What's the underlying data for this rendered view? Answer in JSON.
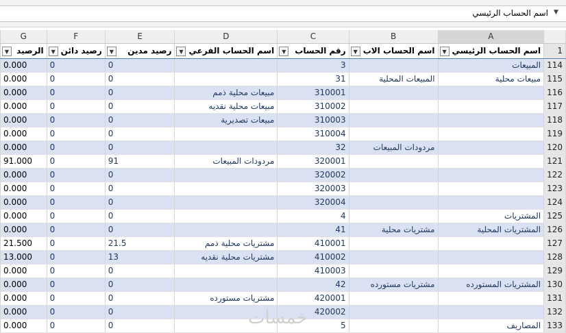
{
  "name_box": {
    "value": "اسم الحساب الرئيسي"
  },
  "columns": [
    "A",
    "B",
    "C",
    "D",
    "E",
    "F",
    "G"
  ],
  "header_row": {
    "num": "1",
    "labels": [
      "اسم الحساب الرئيسي",
      "اسم الحساب الاب",
      "رقم الحساب",
      "اسم الحساب الفرعي",
      "رصيد مدين",
      "رصيد دائن",
      "الرصيد"
    ]
  },
  "rows": [
    {
      "num": "114",
      "a": "المبيعات",
      "b": "",
      "c": "3",
      "d": "",
      "e": "0",
      "f": "0",
      "g": "0.000"
    },
    {
      "num": "115",
      "a": "مبيعات محلية",
      "b": "المبيعات المحلية",
      "c": "31",
      "d": "",
      "e": "0",
      "f": "0",
      "g": "0.000"
    },
    {
      "num": "116",
      "a": "",
      "b": "",
      "c": "310001",
      "d": "مبيعات محلية ذمم",
      "e": "0",
      "f": "0",
      "g": "0.000"
    },
    {
      "num": "117",
      "a": "",
      "b": "",
      "c": "310002",
      "d": "مبيعات محلية نقديه",
      "e": "0",
      "f": "0",
      "g": "0.000"
    },
    {
      "num": "118",
      "a": "",
      "b": "",
      "c": "310003",
      "d": "مبيعات تصديرية",
      "e": "0",
      "f": "0",
      "g": "0.000"
    },
    {
      "num": "119",
      "a": "",
      "b": "",
      "c": "310004",
      "d": "",
      "e": "0",
      "f": "0",
      "g": "0.000"
    },
    {
      "num": "120",
      "a": "",
      "b": "مردودات المبيعات",
      "c": "32",
      "d": "",
      "e": "0",
      "f": "0",
      "g": "0.000"
    },
    {
      "num": "121",
      "a": "",
      "b": "",
      "c": "320001",
      "d": "مردودات المبيعات",
      "e": "91",
      "f": "0",
      "g": "91.000"
    },
    {
      "num": "122",
      "a": "",
      "b": "",
      "c": "320002",
      "d": "",
      "e": "0",
      "f": "0",
      "g": "0.000"
    },
    {
      "num": "123",
      "a": "",
      "b": "",
      "c": "320003",
      "d": "",
      "e": "0",
      "f": "0",
      "g": "0.000"
    },
    {
      "num": "124",
      "a": "",
      "b": "",
      "c": "320004",
      "d": "",
      "e": "0",
      "f": "0",
      "g": "0.000"
    },
    {
      "num": "125",
      "a": "المشتريات",
      "b": "",
      "c": "4",
      "d": "",
      "e": "0",
      "f": "0",
      "g": "0.000"
    },
    {
      "num": "126",
      "a": "المشتريات المحلية",
      "b": "مشتريات محلية",
      "c": "41",
      "d": "",
      "e": "0",
      "f": "0",
      "g": "0.000"
    },
    {
      "num": "127",
      "a": "",
      "b": "",
      "c": "410001",
      "d": "مشتريات محلية ذمم",
      "e": "21.5",
      "f": "0",
      "g": "21.500"
    },
    {
      "num": "128",
      "a": "",
      "b": "",
      "c": "410002",
      "d": "مشتريات محلية نقديه",
      "e": "13",
      "f": "0",
      "g": "13.000"
    },
    {
      "num": "129",
      "a": "",
      "b": "",
      "c": "410003",
      "d": "",
      "e": "0",
      "f": "0",
      "g": "0.000"
    },
    {
      "num": "130",
      "a": "المشتريات المستورده",
      "b": "مشتريات مستورده",
      "c": "42",
      "d": "",
      "e": "0",
      "f": "0",
      "g": "0.000"
    },
    {
      "num": "131",
      "a": "",
      "b": "",
      "c": "420001",
      "d": "مشتريات مستورده",
      "e": "0",
      "f": "0",
      "g": "0.000"
    },
    {
      "num": "132",
      "a": "",
      "b": "",
      "c": "420002",
      "d": "",
      "e": "0",
      "f": "0",
      "g": "0.000"
    },
    {
      "num": "133",
      "a": "المصاريف",
      "b": "",
      "c": "5",
      "d": "",
      "e": "0",
      "f": "0",
      "g": "0.000"
    }
  ],
  "watermark": "خمسات",
  "icons": {
    "filter": "filter-dropdown-icon",
    "namebox": "chevron-down-icon"
  },
  "colors": {
    "band": "#d9e1f2",
    "text": "#1f3864",
    "header_border": "#5b7ec2"
  }
}
